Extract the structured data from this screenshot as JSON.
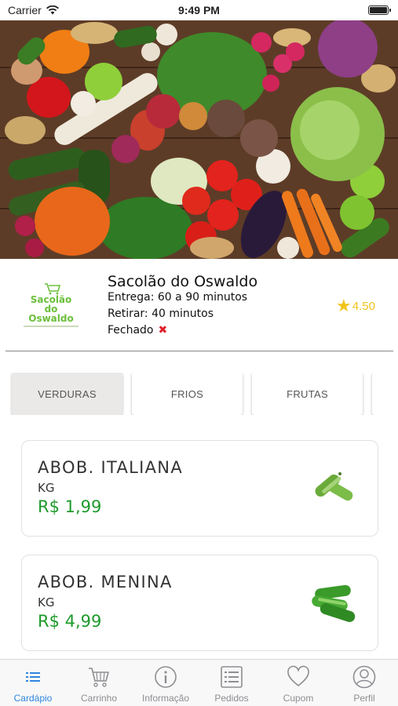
{
  "status_bar": {
    "carrier": "Carrier",
    "time": "9:49 PM"
  },
  "hero": {
    "image": "vegetables-on-wooden-table"
  },
  "store": {
    "logo_lines": [
      "Sacolão",
      "do",
      "Oswaldo"
    ],
    "name": "Sacolão do Oswaldo",
    "delivery": "Entrega: 60 a 90 minutos",
    "pickup": "Retirar: 40 minutos",
    "status": "Fechado",
    "rating": "4.50"
  },
  "categories": [
    {
      "label": "VERDURAS",
      "active": true
    },
    {
      "label": "FRIOS",
      "active": false
    },
    {
      "label": "FRUTAS",
      "active": false
    }
  ],
  "products": [
    {
      "name": "ABOB. ITALIANA",
      "unit": "KG",
      "price": "R$ 1,99",
      "icon": "zucchini-icon"
    },
    {
      "name": "ABOB. MENINA",
      "unit": "KG",
      "price": "R$ 4,99",
      "icon": "zucchini-icon"
    }
  ],
  "tab_bar": [
    {
      "label": "Cardápio",
      "icon": "menu-list-icon",
      "active": true
    },
    {
      "label": "Carrinho",
      "icon": "cart-icon",
      "active": false
    },
    {
      "label": "Informação",
      "icon": "info-icon",
      "active": false
    },
    {
      "label": "Pedidos",
      "icon": "orders-list-icon",
      "active": false
    },
    {
      "label": "Cupom",
      "icon": "heart-icon",
      "active": false
    },
    {
      "label": "Perfil",
      "icon": "profile-icon",
      "active": false
    }
  ],
  "colors": {
    "accent": "#2f86e0",
    "price": "#1e9a2c",
    "rating": "#f2c31b",
    "closed": "#e0202a",
    "logo": "#6bbf3a"
  }
}
